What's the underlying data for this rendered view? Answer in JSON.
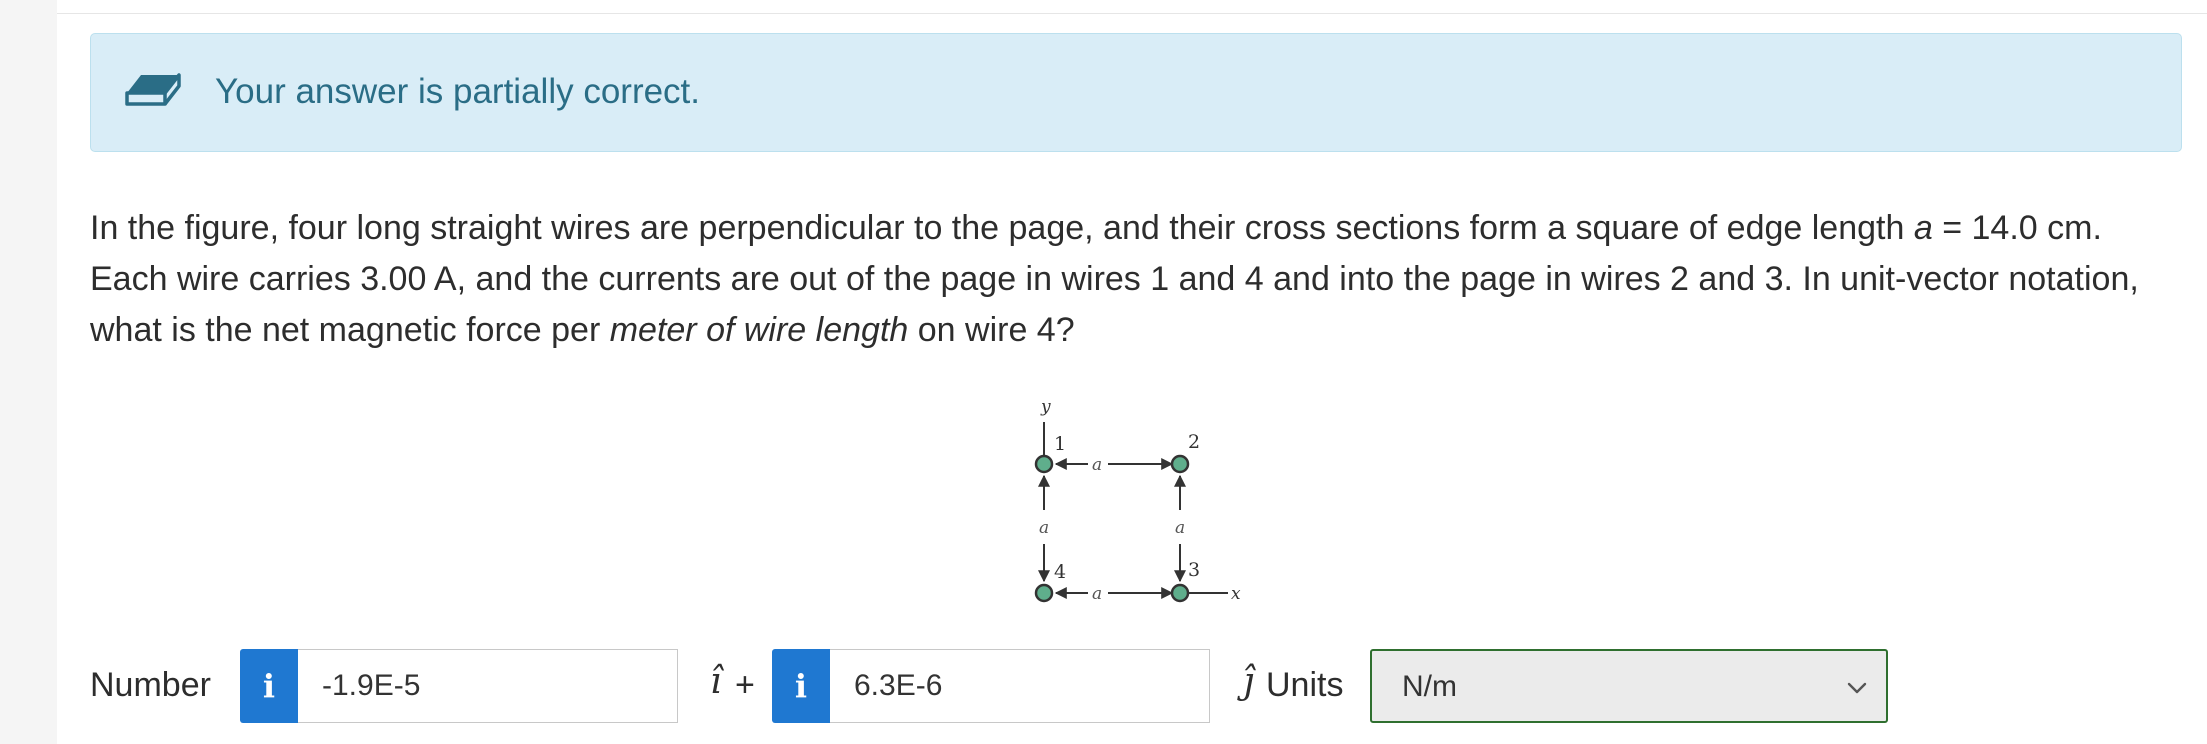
{
  "alert": {
    "message": "Your answer is partially correct.",
    "icon": "eraser-icon",
    "bg_color": "#d9edf7",
    "text_color": "#2a6d86"
  },
  "question": {
    "part1": "In the figure, four long straight wires are perpendicular to the page, and their cross sections form a square of edge length ",
    "var_a": "a",
    "part2": " = 14.0 cm. Each wire carries 3.00 A, and the currents are out of the page in wires 1 and 4 and into the page in wires 2 and 3. In unit-vector notation, what is the net magnetic force per ",
    "emphasis": "meter of wire length",
    "part3": " on wire 4?"
  },
  "figure": {
    "axis_y": "y",
    "axis_x": "x",
    "wire_1": "1",
    "wire_2": "2",
    "wire_3": "3",
    "wire_4": "4",
    "edge_top": "a",
    "edge_bottom": "a",
    "edge_left": "a",
    "edge_right": "a",
    "wire_color": "#5fae8c"
  },
  "answer": {
    "label": "Number",
    "i_component": "-1.9E-5",
    "i_hat": "î",
    "plus": "+",
    "j_component": "6.3E-6",
    "j_hat": "ĵ",
    "units_label": "Units",
    "units_value": "N/m",
    "info_icon": "info-icon",
    "info_color": "#1f78d1"
  }
}
